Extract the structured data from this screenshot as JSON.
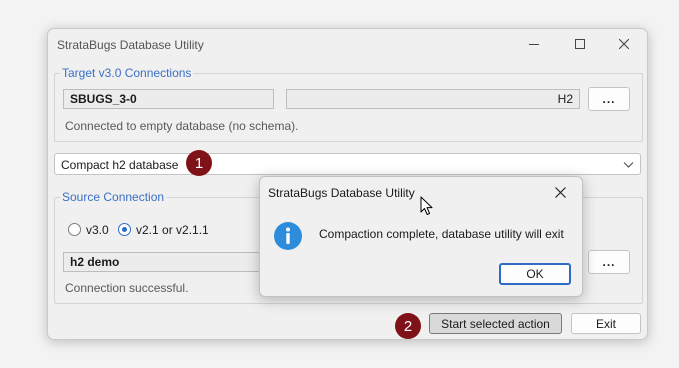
{
  "window": {
    "title": "StrataBugs Database Utility",
    "controls": [
      "minimize-icon",
      "maximize-icon",
      "close-icon"
    ]
  },
  "target_group": {
    "legend": "Target v3.0 Connections",
    "connection_name": "SBUGS_3-0",
    "connection_type": "H2",
    "browse_label": "...",
    "status": "Connected to empty database (no schema)."
  },
  "action_combo": {
    "selected": "Compact h2 database",
    "icon": "chevron-down-icon"
  },
  "source_group": {
    "legend": "Source Connection",
    "radio_v30_label": "v3.0",
    "radio_v21_label": "v2.1 or v2.1.1",
    "selected_version": "v2.1 or v2.1.1",
    "connection_name": "h2 demo",
    "browse_label": "...",
    "status": "Connection successful."
  },
  "footer": {
    "start_label": "Start selected action",
    "exit_label": "Exit"
  },
  "step_badges": [
    "1",
    "2"
  ],
  "dialog": {
    "title": "StrataBugs Database Utility",
    "message": "Compaction complete, database utility will exit",
    "ok_label": "OK",
    "icon": "info-icon"
  },
  "colors": {
    "accent": "#2f6cc8",
    "legend_text": "#3b6fc4",
    "badge": "#7f1218",
    "info_icon": "#2d8ddb"
  }
}
